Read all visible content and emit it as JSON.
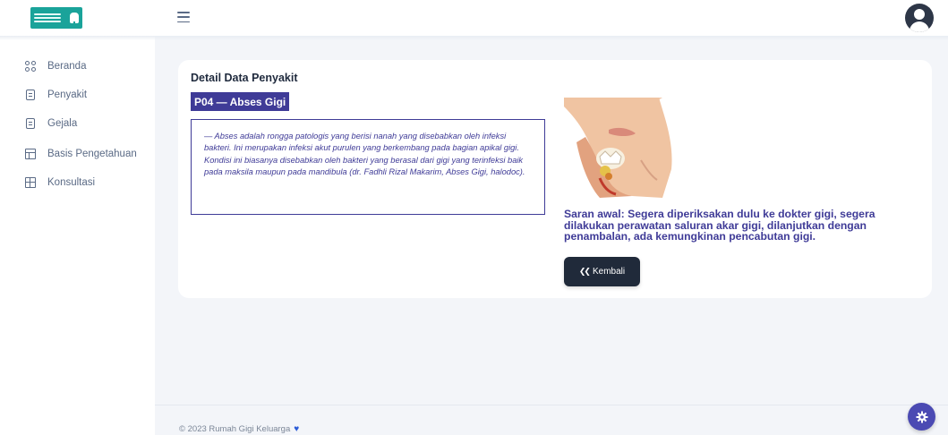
{
  "header": {
    "menu_icon": "hamburger-icon",
    "avatar_icon": "user-avatar-icon"
  },
  "sidebar": {
    "items": [
      {
        "label": "Beranda",
        "icon": "grid-icon"
      },
      {
        "label": "Penyakit",
        "icon": "document-icon"
      },
      {
        "label": "Gejala",
        "icon": "document-icon"
      },
      {
        "label": "Basis Pengetahuan",
        "icon": "table-icon"
      },
      {
        "label": "Konsultasi",
        "icon": "grid-plus-icon"
      }
    ]
  },
  "detail": {
    "title": "Detail Data Penyakit",
    "badge": "P04 — Abses Gigi",
    "description": "— Abses adalah rongga patologis yang berisi nanah yang disebabkan oleh infeksi bakteri. Ini merupakan infeksi akut purulen yang berkembang pada bagian apikal gigi. Kondisi ini biasanya disebabkan oleh bakteri yang berasal dari gigi yang terinfeksi baik pada maksila maupun pada mandibula (dr. Fadhli Rizal Makarim, Abses Gigi, halodoc).",
    "saran": "Saran awal: Segera diperiksakan dulu ke dokter gigi, segera dilakukan perawatan saluran akar gigi, dilanjutkan dengan penambalan, ada kemungkinan pencabutan gigi.",
    "back_label": "Kembali",
    "back_icon": "double-chevron-left-icon"
  },
  "footer": {
    "text": "© 2023 Rumah Gigi Keluarga",
    "heart": "♥"
  },
  "colors": {
    "accent": "#3f3b97",
    "button": "#202a3a",
    "fab": "#4b4ab3",
    "logo": "#1aa39a"
  }
}
